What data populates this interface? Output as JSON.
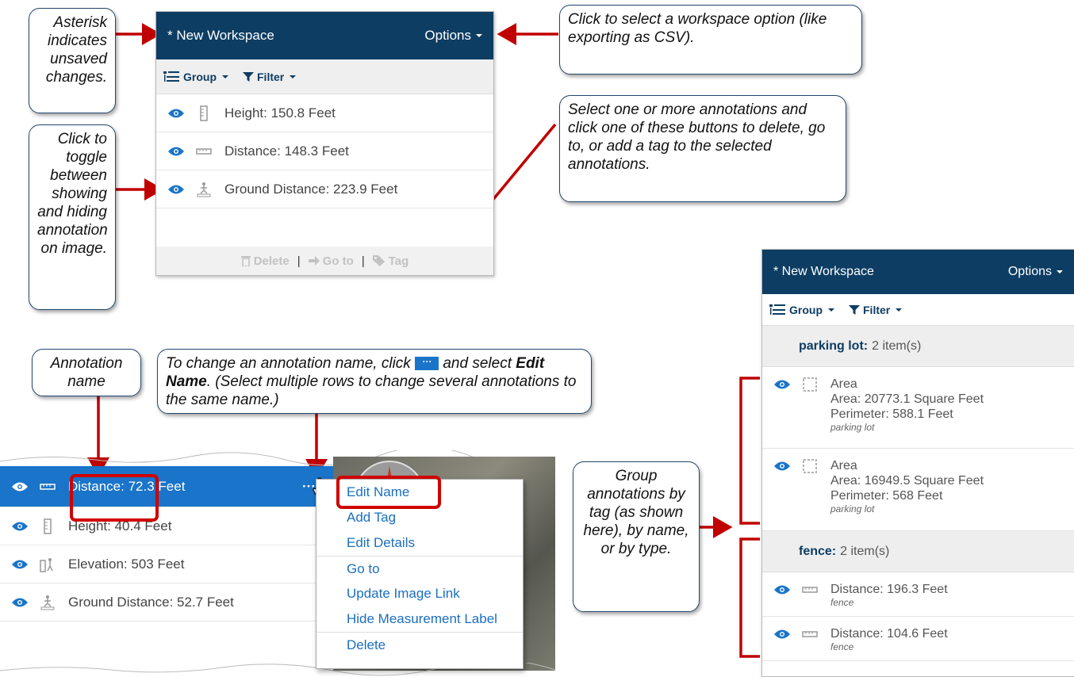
{
  "workspace1": {
    "title": "* New Workspace",
    "options_label": "Options",
    "group_label": "Group",
    "filter_label": "Filter",
    "rows": [
      {
        "label": "Height: 150.8 Feet"
      },
      {
        "label": "Distance: 148.3 Feet"
      },
      {
        "label": "Ground Distance: 223.9 Feet"
      }
    ],
    "footer": {
      "delete": "Delete",
      "goto": "Go to",
      "tag": "Tag",
      "sep": "|"
    }
  },
  "callouts": {
    "asterisk": "Asterisk indicates unsaved changes.",
    "options": "Click to select a workspace option (like exporting as CSV).",
    "toggle": "Click to toggle between showing and hiding annotation on image.",
    "select_buttons": "Select one or more annotations and click one of these buttons to delete, go to, or add a tag to the selected annotations.",
    "annotation_name": "Annotation name",
    "change_name_pre": "To change an annotation name, click",
    "change_name_mid": "and select",
    "change_name_bold": "Edit Name",
    "change_name_post": ". (Select multiple rows to change several annotations to the same name.)",
    "dots": "···",
    "group_by": "Group annotations by tag (as shown here), by name, or by type."
  },
  "list2": {
    "rows": [
      {
        "label": "Distance: 72.3 Feet",
        "selected": true
      },
      {
        "label": "Height: 40.4 Feet"
      },
      {
        "label": "Elevation: 503 Feet"
      },
      {
        "label": "Ground Distance: 52.7 Feet"
      }
    ],
    "dots": "···"
  },
  "context_menu": {
    "items": [
      "Edit Name",
      "Add Tag",
      "Edit Details",
      "Go to",
      "Update Image Link",
      "Hide Measurement Label",
      "Delete"
    ]
  },
  "workspace2": {
    "title": "* New Workspace",
    "options_label": "Options",
    "group_label": "Group",
    "filter_label": "Filter",
    "groups": [
      {
        "name": "parking lot:",
        "count": "2 item(s)",
        "items": [
          {
            "type": "Area",
            "line1": "Area: 20773.1 Square Feet",
            "line2": "Perimeter: 588.1 Feet",
            "tag": "parking lot"
          },
          {
            "type": "Area",
            "line1": "Area: 16949.5 Square Feet",
            "line2": "Perimeter: 568 Feet",
            "tag": "parking lot"
          }
        ]
      },
      {
        "name": "fence:",
        "count": "2 item(s)",
        "items": [
          {
            "type": "Distance: 196.3 Feet",
            "tag": "fence"
          },
          {
            "type": "Distance: 104.6 Feet",
            "tag": "fence"
          }
        ]
      }
    ]
  },
  "colors": {
    "header": "#0d3d63",
    "accent": "#1a74c9",
    "arrow": "#c00000",
    "link": "#1a6fbf"
  },
  "icons": [
    "eye-icon",
    "height-icon",
    "distance-icon",
    "ground-distance-icon",
    "elevation-icon",
    "area-icon",
    "group-icon",
    "filter-icon",
    "trash-icon",
    "goto-arrow-icon",
    "tag-icon",
    "hand-cursor-icon"
  ]
}
